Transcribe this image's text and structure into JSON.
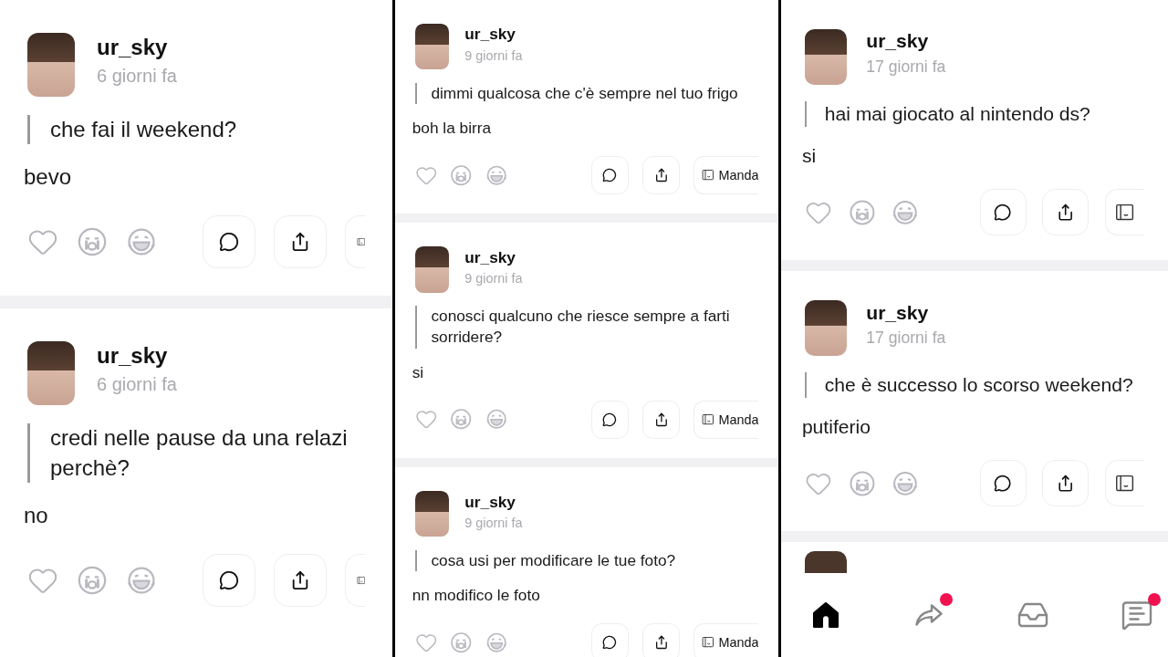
{
  "panels": [
    {
      "posts": [
        {
          "kind": "post",
          "username": "ur_sky",
          "time": "6 giorni fa",
          "question": "che fai il weekend?",
          "answer": "bevo"
        },
        {
          "kind": "post",
          "username": "ur_sky",
          "time": "6 giorni fa",
          "question": "credi nelle pause da una relazi\nperchè?",
          "answer": "no"
        }
      ]
    },
    {
      "posts": [
        {
          "kind": "post",
          "username": "ur_sky",
          "time": "9 giorni fa",
          "question": "dimmi qualcosa che c'è sempre nel tuo frigo",
          "answer": "boh la birra",
          "send_label": "Manda"
        },
        {
          "kind": "post",
          "username": "ur_sky",
          "time": "9 giorni fa",
          "question": "conosci qualcuno che riesce sempre a farti sorridere?",
          "answer": "si",
          "send_label": "Manda"
        },
        {
          "kind": "post",
          "username": "ur_sky",
          "time": "9 giorni fa",
          "question": "cosa usi per modificare le tue foto?",
          "answer": "nn modifico le foto",
          "send_label": "Manda"
        }
      ]
    },
    {
      "posts": [
        {
          "kind": "post",
          "username": "ur_sky",
          "time": "17 giorni fa",
          "question": "hai mai giocato al nintendo ds?",
          "answer": "si"
        },
        {
          "kind": "post",
          "username": "ur_sky",
          "time": "17 giorni fa",
          "question": "che è successo lo scorso weekend?",
          "answer": "putiferio"
        },
        {
          "kind": "peek"
        }
      ],
      "bottom_nav": [
        {
          "kind": "home",
          "selected": true,
          "badge": false
        },
        {
          "kind": "share",
          "selected": false,
          "badge": true
        },
        {
          "kind": "inbox",
          "selected": false,
          "badge": false
        },
        {
          "kind": "chat",
          "selected": false,
          "badge": true
        }
      ]
    }
  ]
}
